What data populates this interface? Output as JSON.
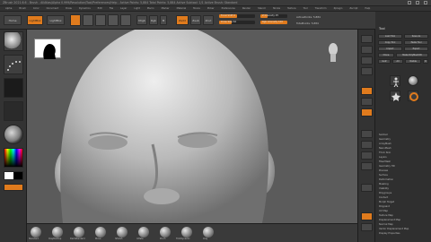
{
  "window": {
    "title": "ZBrush 2021.6.6 - Brush - AllAtlas/Alpha 0.999/Resolution/Tool/Preferences/Help - Active Points: 5,884 Total Points: 5,884 Active Subtool: 1/1 Active Brush: Standard"
  },
  "menu": [
    "Alpha",
    "Brush",
    "Color",
    "Document",
    "Draw",
    "Dynamics",
    "Edit",
    "File",
    "Layer",
    "Light",
    "Macro",
    "Marker",
    "Material",
    "Movie",
    "Picker",
    "Preferences",
    "Render",
    "Stencil",
    "Stroke",
    "Texture",
    "Tool",
    "Transform",
    "Zplugin",
    "Zscript",
    "Help"
  ],
  "top_shelf": {
    "home_label": "Home",
    "lightbox_label": "LightBox",
    "edit_label": "Edit",
    "draw_label": "Draw",
    "move_label": "Move",
    "scale_label": "Scale",
    "rotate_label": "Rotate",
    "mrgb_label": "Mrgb",
    "rgb_label": "Rgb",
    "m_label": "M",
    "zadd_label": "Zadd",
    "zsub_label": "Zsub",
    "zcut_label": "Zcut",
    "focal_label": "Focal Shift 0",
    "draw_size_label": "Draw Size 64",
    "z_intensity_label": "Z Intensity 25",
    "rgb_intensity_label": "Rgb Intensity 100",
    "focal_shift": 0.5,
    "draw_size": 0.35,
    "z_intensity": 0.25,
    "rgb_intensity": 1.0,
    "active_points": "ActivePoints: 5,884",
    "total_points": "TotalPoints: 5,884"
  },
  "bottom_shelf": {
    "brushes": [
      "Standard",
      "ClayBuildup",
      "DamStandard",
      "Move",
      "hPolish",
      "Inflate",
      "Pinch",
      "TrimDynamic",
      "Clay",
      "SnakeHook"
    ]
  },
  "right_panel": {
    "title": "Tool",
    "buttons": [
      "Load Tool",
      "Save As",
      "Copy Tool",
      "Paste Tool",
      "Import",
      "Export",
      "Clone",
      "Make PolyMesh3D",
      "GoZ",
      "All",
      "Visible",
      "R"
    ],
    "subtools": [
      "Subtool",
      "Geometry",
      "ArrayMesh",
      "NanoMesh",
      "Thick Skin",
      "Layers",
      "FiberMesh",
      "Geometry HD",
      "Preview",
      "Surface",
      "Deformation",
      "Masking",
      "Visibility",
      "Polygroups",
      "Contact",
      "Morph Target",
      "Polypaint",
      "UV Map",
      "Texture Map",
      "Displacement Map",
      "Normal Map",
      "Vector Displacement Map",
      "Display Properties"
    ]
  },
  "colors": {
    "accent": "#e07b1d",
    "canvas": "#5b5b5b",
    "panel": "#333333"
  }
}
